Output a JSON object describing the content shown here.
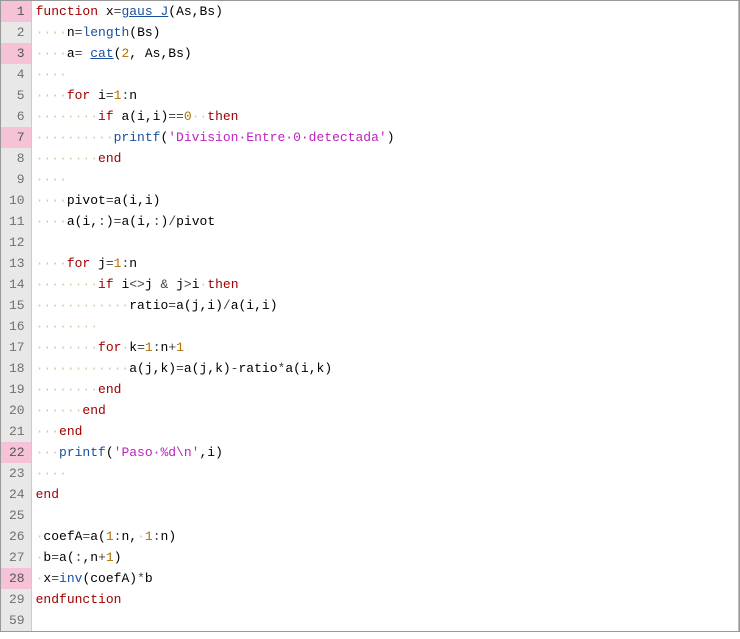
{
  "editor": {
    "gutter": [
      {
        "n": "1",
        "hl": true
      },
      {
        "n": "2",
        "hl": false
      },
      {
        "n": "3",
        "hl": true
      },
      {
        "n": "4",
        "hl": false
      },
      {
        "n": "5",
        "hl": false
      },
      {
        "n": "6",
        "hl": false
      },
      {
        "n": "7",
        "hl": true
      },
      {
        "n": "8",
        "hl": false
      },
      {
        "n": "9",
        "hl": false
      },
      {
        "n": "10",
        "hl": false
      },
      {
        "n": "11",
        "hl": false
      },
      {
        "n": "12",
        "hl": false
      },
      {
        "n": "13",
        "hl": false
      },
      {
        "n": "14",
        "hl": false
      },
      {
        "n": "15",
        "hl": false
      },
      {
        "n": "16",
        "hl": false
      },
      {
        "n": "17",
        "hl": false
      },
      {
        "n": "18",
        "hl": false
      },
      {
        "n": "19",
        "hl": false
      },
      {
        "n": "20",
        "hl": false
      },
      {
        "n": "21",
        "hl": false
      },
      {
        "n": "22",
        "hl": true
      },
      {
        "n": "23",
        "hl": false
      },
      {
        "n": "24",
        "hl": false
      },
      {
        "n": "25",
        "hl": false
      },
      {
        "n": "26",
        "hl": false
      },
      {
        "n": "27",
        "hl": false
      },
      {
        "n": "28",
        "hl": true
      },
      {
        "n": "29",
        "hl": false
      },
      {
        "n": "59",
        "hl": false
      }
    ],
    "lines": [
      [
        {
          "c": "kw",
          "t": "function"
        },
        {
          "c": "id",
          "t": " x"
        },
        {
          "c": "op",
          "t": "="
        },
        {
          "c": "fn",
          "t": "gaus_J"
        },
        {
          "c": "id",
          "t": "(As,Bs)"
        }
      ],
      [
        {
          "c": "ws",
          "t": "····"
        },
        {
          "c": "id",
          "t": "n"
        },
        {
          "c": "op",
          "t": "="
        },
        {
          "c": "fn-nou",
          "t": "length"
        },
        {
          "c": "id",
          "t": "(Bs)"
        }
      ],
      [
        {
          "c": "ws",
          "t": "····"
        },
        {
          "c": "id",
          "t": "a"
        },
        {
          "c": "op",
          "t": "= "
        },
        {
          "c": "fn",
          "t": "cat"
        },
        {
          "c": "id",
          "t": "("
        },
        {
          "c": "num",
          "t": "2"
        },
        {
          "c": "id",
          "t": ", As,Bs)"
        }
      ],
      [
        {
          "c": "ws",
          "t": "····"
        }
      ],
      [
        {
          "c": "ws",
          "t": "····"
        },
        {
          "c": "kw",
          "t": "for"
        },
        {
          "c": "id",
          "t": " i"
        },
        {
          "c": "op",
          "t": "="
        },
        {
          "c": "num",
          "t": "1"
        },
        {
          "c": "op",
          "t": ":"
        },
        {
          "c": "id",
          "t": "n"
        }
      ],
      [
        {
          "c": "ws",
          "t": "········"
        },
        {
          "c": "kw",
          "t": "if"
        },
        {
          "c": "id",
          "t": " a(i,i)"
        },
        {
          "c": "op",
          "t": "=="
        },
        {
          "c": "num",
          "t": "0"
        },
        {
          "c": "ws",
          "t": "··"
        },
        {
          "c": "kw",
          "t": "then"
        }
      ],
      [
        {
          "c": "ws",
          "t": "··········"
        },
        {
          "c": "fn-nou",
          "t": "printf"
        },
        {
          "c": "id",
          "t": "("
        },
        {
          "c": "str",
          "t": "'Division·Entre·0·detectada'"
        },
        {
          "c": "id",
          "t": ")"
        }
      ],
      [
        {
          "c": "ws",
          "t": "········"
        },
        {
          "c": "kw",
          "t": "end"
        }
      ],
      [
        {
          "c": "ws",
          "t": "····"
        }
      ],
      [
        {
          "c": "ws",
          "t": "····"
        },
        {
          "c": "id",
          "t": "pivot"
        },
        {
          "c": "op",
          "t": "="
        },
        {
          "c": "id",
          "t": "a(i,i)"
        }
      ],
      [
        {
          "c": "ws",
          "t": "····"
        },
        {
          "c": "id",
          "t": "a(i,"
        },
        {
          "c": "op",
          "t": ":"
        },
        {
          "c": "id",
          "t": ")"
        },
        {
          "c": "op",
          "t": "="
        },
        {
          "c": "id",
          "t": "a(i,"
        },
        {
          "c": "op",
          "t": ":"
        },
        {
          "c": "id",
          "t": ")"
        },
        {
          "c": "op",
          "t": "/"
        },
        {
          "c": "id",
          "t": "pivot"
        }
      ],
      [
        {
          "c": "ws",
          "t": ""
        }
      ],
      [
        {
          "c": "ws",
          "t": "····"
        },
        {
          "c": "kw",
          "t": "for"
        },
        {
          "c": "id",
          "t": " j"
        },
        {
          "c": "op",
          "t": "="
        },
        {
          "c": "num",
          "t": "1"
        },
        {
          "c": "op",
          "t": ":"
        },
        {
          "c": "id",
          "t": "n"
        }
      ],
      [
        {
          "c": "ws",
          "t": "········"
        },
        {
          "c": "kw",
          "t": "if"
        },
        {
          "c": "id",
          "t": " i"
        },
        {
          "c": "op",
          "t": "<>"
        },
        {
          "c": "id",
          "t": "j "
        },
        {
          "c": "op",
          "t": "&"
        },
        {
          "c": "id",
          "t": " j"
        },
        {
          "c": "op",
          "t": ">"
        },
        {
          "c": "id",
          "t": "i"
        },
        {
          "c": "ws",
          "t": "·"
        },
        {
          "c": "kw",
          "t": "then"
        }
      ],
      [
        {
          "c": "ws",
          "t": "············"
        },
        {
          "c": "id",
          "t": "ratio"
        },
        {
          "c": "op",
          "t": "="
        },
        {
          "c": "id",
          "t": "a(j,i)"
        },
        {
          "c": "op",
          "t": "/"
        },
        {
          "c": "id",
          "t": "a(i,i)"
        }
      ],
      [
        {
          "c": "ws",
          "t": "········"
        }
      ],
      [
        {
          "c": "ws",
          "t": "········"
        },
        {
          "c": "kw",
          "t": "for"
        },
        {
          "c": "ws",
          "t": "·"
        },
        {
          "c": "id",
          "t": "k"
        },
        {
          "c": "op",
          "t": "="
        },
        {
          "c": "num",
          "t": "1"
        },
        {
          "c": "op",
          "t": ":"
        },
        {
          "c": "id",
          "t": "n"
        },
        {
          "c": "op",
          "t": "+"
        },
        {
          "c": "num",
          "t": "1"
        }
      ],
      [
        {
          "c": "ws",
          "t": "············"
        },
        {
          "c": "id",
          "t": "a(j,k)"
        },
        {
          "c": "op",
          "t": "="
        },
        {
          "c": "id",
          "t": "a(j,k)"
        },
        {
          "c": "op",
          "t": "-"
        },
        {
          "c": "id",
          "t": "ratio"
        },
        {
          "c": "op",
          "t": "*"
        },
        {
          "c": "id",
          "t": "a(i,k)"
        }
      ],
      [
        {
          "c": "ws",
          "t": "········"
        },
        {
          "c": "kw",
          "t": "end"
        }
      ],
      [
        {
          "c": "ws",
          "t": "······"
        },
        {
          "c": "kw",
          "t": "end"
        }
      ],
      [
        {
          "c": "ws",
          "t": "···"
        },
        {
          "c": "kw",
          "t": "end"
        }
      ],
      [
        {
          "c": "ws",
          "t": "···"
        },
        {
          "c": "fn-nou",
          "t": "printf"
        },
        {
          "c": "id",
          "t": "("
        },
        {
          "c": "str",
          "t": "'Paso·%d\\n'"
        },
        {
          "c": "id",
          "t": ",i)"
        }
      ],
      [
        {
          "c": "ws",
          "t": "····"
        }
      ],
      [
        {
          "c": "kw",
          "t": "end"
        }
      ],
      [
        {
          "c": "ws",
          "t": ""
        }
      ],
      [
        {
          "c": "ws",
          "t": "·"
        },
        {
          "c": "id",
          "t": "coefA"
        },
        {
          "c": "op",
          "t": "="
        },
        {
          "c": "id",
          "t": "a("
        },
        {
          "c": "num",
          "t": "1"
        },
        {
          "c": "op",
          "t": ":"
        },
        {
          "c": "id",
          "t": "n,"
        },
        {
          "c": "ws",
          "t": "·"
        },
        {
          "c": "num",
          "t": "1"
        },
        {
          "c": "op",
          "t": ":"
        },
        {
          "c": "id",
          "t": "n)"
        }
      ],
      [
        {
          "c": "ws",
          "t": "·"
        },
        {
          "c": "id",
          "t": "b"
        },
        {
          "c": "op",
          "t": "="
        },
        {
          "c": "id",
          "t": "a("
        },
        {
          "c": "op",
          "t": ":"
        },
        {
          "c": "id",
          "t": ",n"
        },
        {
          "c": "op",
          "t": "+"
        },
        {
          "c": "num",
          "t": "1"
        },
        {
          "c": "id",
          "t": ")"
        }
      ],
      [
        {
          "c": "ws",
          "t": "·"
        },
        {
          "c": "id",
          "t": "x"
        },
        {
          "c": "op",
          "t": "="
        },
        {
          "c": "fn-nou",
          "t": "inv"
        },
        {
          "c": "id",
          "t": "(coefA)"
        },
        {
          "c": "op",
          "t": "*"
        },
        {
          "c": "id",
          "t": "b"
        }
      ],
      [
        {
          "c": "kw",
          "t": "endfunction"
        }
      ],
      [
        {
          "c": "ws",
          "t": ""
        }
      ]
    ]
  }
}
